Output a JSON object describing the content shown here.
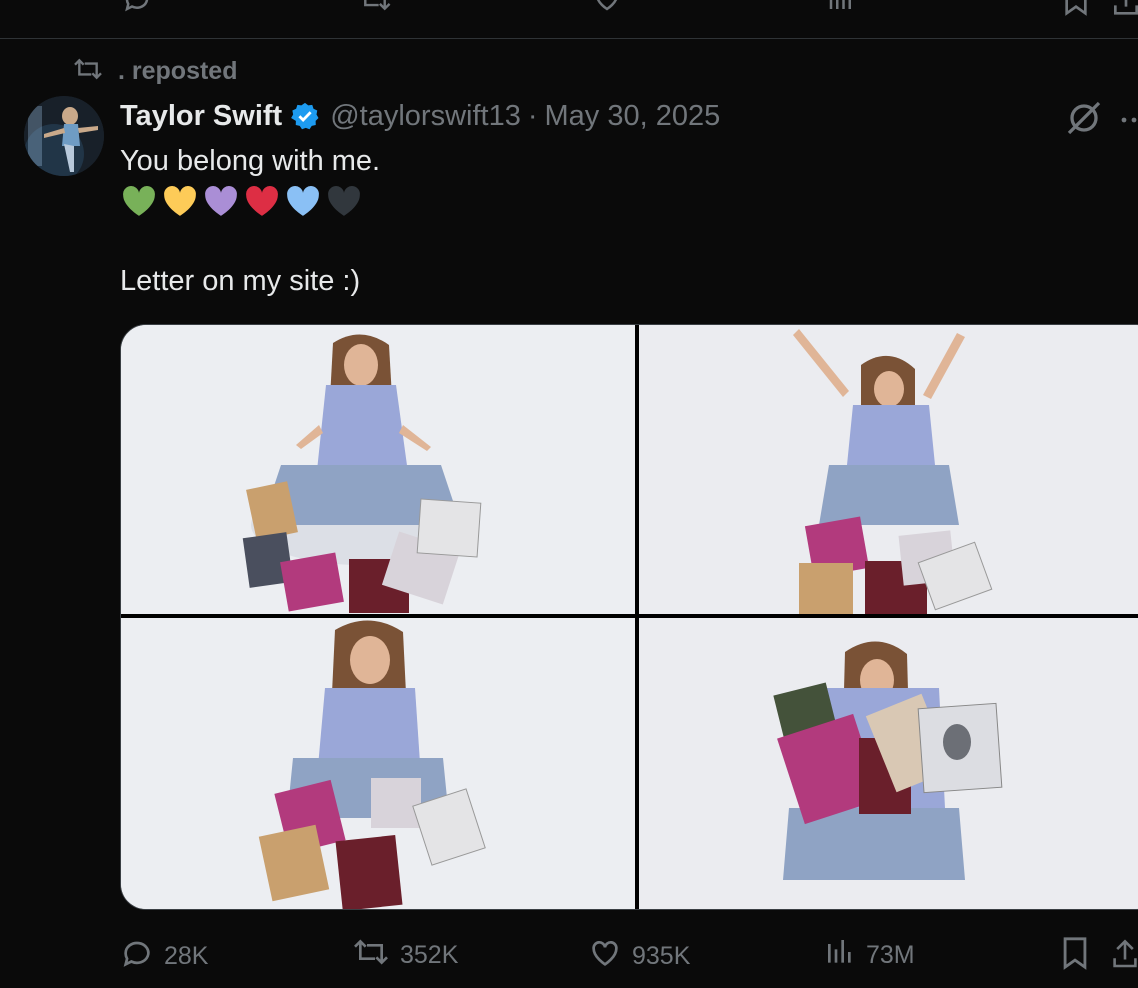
{
  "repost": {
    "label": ". reposted"
  },
  "tweet": {
    "author_name": "Taylor Swift",
    "handle": "@taylorswift13",
    "separator": "·",
    "date": "May 30, 2025",
    "text_line1": "You belong with me.",
    "hearts": [
      {
        "name": "green-heart",
        "color": "#78b159"
      },
      {
        "name": "yellow-heart",
        "color": "#fdcb58"
      },
      {
        "name": "purple-heart",
        "color": "#aa8ed6"
      },
      {
        "name": "red-heart",
        "color": "#dd2e44"
      },
      {
        "name": "blue-heart",
        "color": "#8ac0f5"
      },
      {
        "name": "black-heart",
        "color": "#31373d"
      }
    ],
    "text_line2": "Letter on my site :)"
  },
  "stats": {
    "replies": "28K",
    "reposts": "352K",
    "likes": "935K",
    "views": "73M"
  },
  "colors": {
    "background": "#0a0a0a",
    "text": "#e7e9ea",
    "muted": "#71767b",
    "verified": "#1d9bf0",
    "divider": "#2f3336"
  }
}
